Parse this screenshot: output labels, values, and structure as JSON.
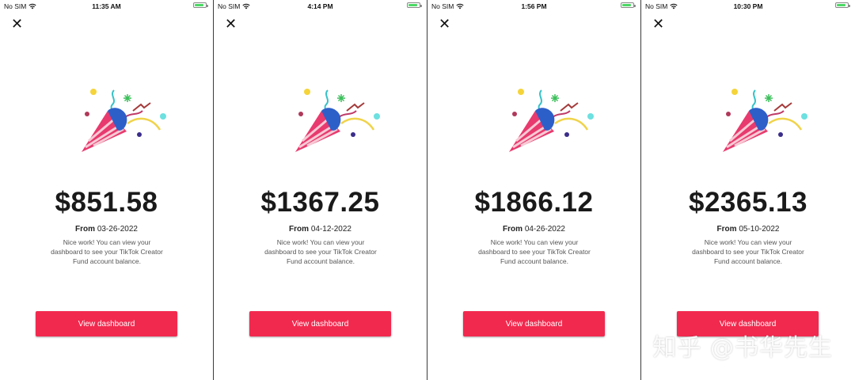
{
  "screens": [
    {
      "carrier": "No SIM",
      "time": "11:35 AM",
      "amount": "$851.58",
      "from_label": "From",
      "from_date": "03-26-2022",
      "description": "Nice work! You can view your dashboard to see your TikTok Creator Fund account balance.",
      "button_label": "View dashboard"
    },
    {
      "carrier": "No SIM",
      "time": "4:14 PM",
      "amount": "$1367.25",
      "from_label": "From",
      "from_date": "04-12-2022",
      "description": "Nice work! You can view your dashboard to see your TikTok Creator Fund account balance.",
      "button_label": "View dashboard"
    },
    {
      "carrier": "No SIM",
      "time": "1:56 PM",
      "amount": "$1866.12",
      "from_label": "From",
      "from_date": "04-26-2022",
      "description": "Nice work! You can view your dashboard to see your TikTok Creator Fund account balance.",
      "button_label": "View dashboard"
    },
    {
      "carrier": "No SIM",
      "time": "10:30 PM",
      "amount": "$2365.13",
      "from_label": "From",
      "from_date": "05-10-2022",
      "description": "Nice work! You can view your dashboard to see your TikTok Creator Fund account balance.",
      "button_label": "View dashboard"
    }
  ],
  "icons": {
    "close": "close-icon",
    "wifi": "wifi-icon",
    "battery": "battery-icon",
    "party": "party-popper-icon",
    "close_glyph": "✕"
  },
  "colors": {
    "button": "#f2294e",
    "battery": "#4cd964"
  },
  "battery_level": 0.85,
  "watermark": "知乎 @书华先生"
}
